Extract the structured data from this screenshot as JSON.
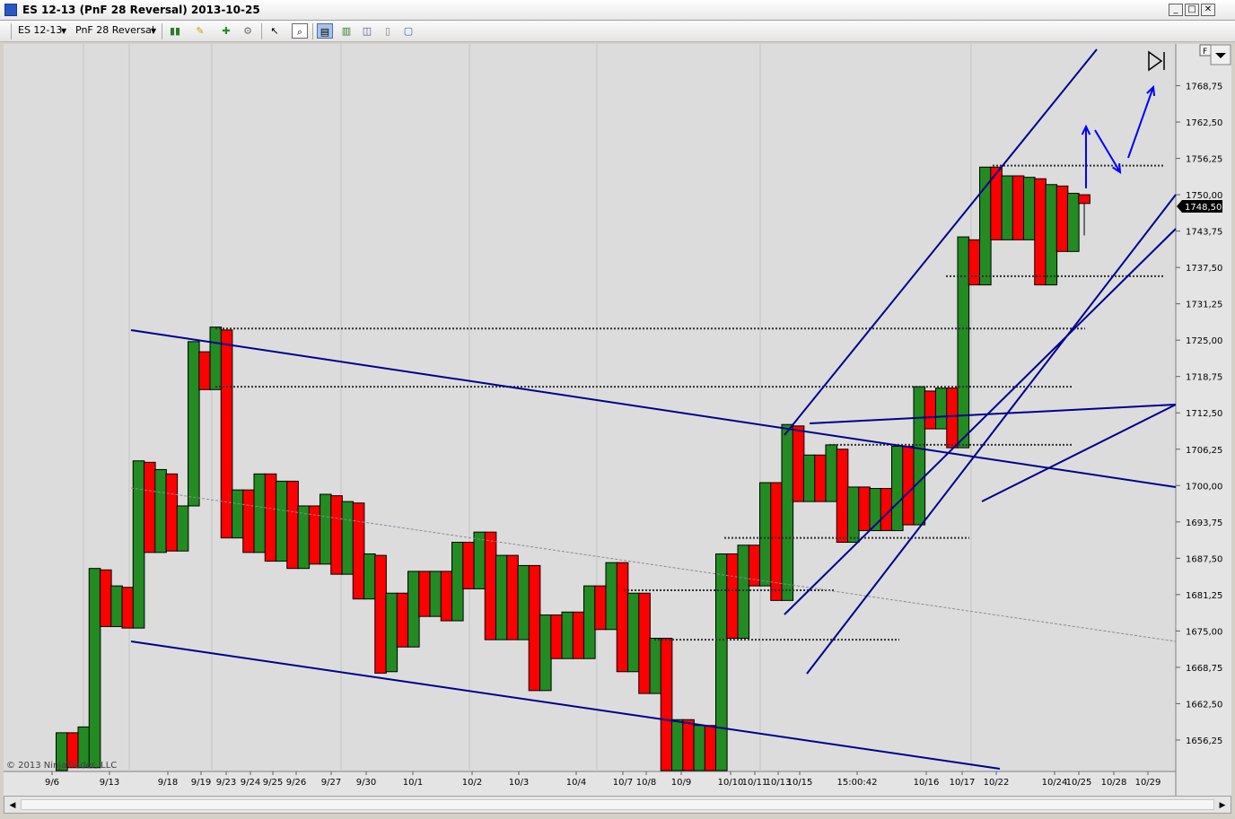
{
  "window": {
    "title": "ES 12-13 (PnF 28 Reversal)  2013-10-25",
    "buttons": [
      "_",
      "□",
      "✕"
    ]
  },
  "toolbar": {
    "instrument": "ES 12-13",
    "period": "PnF 28 Reversal",
    "icons": [
      "bar-style-icon",
      "draw-pencil-icon",
      "add-indicator-icon",
      "strategy-icon",
      "cursor-icon",
      "zoom-icon",
      "chart-trader-icon",
      "data-box-icon",
      "indicator-icon",
      "properties-icon",
      "template-icon"
    ]
  },
  "colors": {
    "up": "#228b22",
    "down": "#ff0000",
    "trendline": "#00008b",
    "arrow": "#0000ff",
    "background": "#dcdcdc"
  },
  "chart_data": {
    "type": "bar",
    "subtype": "point-and-figure reversal columns",
    "ylim": [
      1651,
      1775
    ],
    "grid": true,
    "copyright": "© 2013 NinjaTrader, LLC",
    "last_price_label": "1748,50",
    "y_ticks": [
      "1768,75",
      "1762,50",
      "1756,25",
      "1750,00",
      "1743,75",
      "1737,50",
      "1731,25",
      "1725,00",
      "1718,75",
      "1712,50",
      "1706,25",
      "1700,00",
      "1693,75",
      "1687,50",
      "1681,25",
      "1675,00",
      "1668,75",
      "1662,50",
      "1656,25"
    ],
    "x_ticks": [
      "9/6",
      "9/13",
      "9/18",
      "9/19",
      "9/23",
      "9/24",
      "9/25",
      "9/26",
      "9/27",
      "9/30",
      "10/1",
      "10/2",
      "10/3",
      "10/4",
      "10/7",
      "10/8",
      "10/9",
      "10/10",
      "10/11",
      "10/13",
      "10/15",
      "15:00:42",
      "10/16",
      "10/17",
      "10/22",
      "10/24",
      "10/25",
      "10/28",
      "10/29"
    ],
    "columns": [
      {
        "o": 1651,
        "c": 1657.5
      },
      {
        "o": 1657.5,
        "c": 1651.5
      },
      {
        "o": 1651.5,
        "c": 1658.5
      },
      {
        "o": 1651.5,
        "c": 1685.75
      },
      {
        "o": 1685.5,
        "c": 1675.75
      },
      {
        "o": 1675.75,
        "c": 1682.75
      },
      {
        "o": 1682.5,
        "c": 1675.5
      },
      {
        "o": 1675.5,
        "c": 1704.25
      },
      {
        "o": 1704,
        "c": 1688.5
      },
      {
        "o": 1688.5,
        "c": 1702.75
      },
      {
        "o": 1702,
        "c": 1688.75
      },
      {
        "o": 1688.75,
        "c": 1696.5
      },
      {
        "o": 1696.5,
        "c": 1724.75
      },
      {
        "o": 1723,
        "c": 1716.5
      },
      {
        "o": 1716.5,
        "c": 1727.25
      },
      {
        "o": 1726.75,
        "c": 1691
      },
      {
        "o": 1691,
        "c": 1699.25
      },
      {
        "o": 1699.25,
        "c": 1688.5
      },
      {
        "o": 1688.5,
        "c": 1702
      },
      {
        "o": 1702,
        "c": 1687
      },
      {
        "o": 1687,
        "c": 1700.75
      },
      {
        "o": 1700.75,
        "c": 1685.75
      },
      {
        "o": 1685.75,
        "c": 1696.5
      },
      {
        "o": 1696.5,
        "c": 1686.5
      },
      {
        "o": 1686.5,
        "c": 1698.5
      },
      {
        "o": 1698.25,
        "c": 1684.75
      },
      {
        "o": 1684.75,
        "c": 1697.25
      },
      {
        "o": 1697,
        "c": 1680.5
      },
      {
        "o": 1680.5,
        "c": 1688.25
      },
      {
        "o": 1688,
        "c": 1667.75
      },
      {
        "o": 1668,
        "c": 1681.5
      },
      {
        "o": 1681.5,
        "c": 1672.25
      },
      {
        "o": 1672.25,
        "c": 1685.25
      },
      {
        "o": 1685.25,
        "c": 1677.5
      },
      {
        "o": 1677.5,
        "c": 1685.25
      },
      {
        "o": 1685.25,
        "c": 1676.75
      },
      {
        "o": 1676.75,
        "c": 1690.25
      },
      {
        "o": 1690.25,
        "c": 1682.25
      },
      {
        "o": 1682.25,
        "c": 1692
      },
      {
        "o": 1692,
        "c": 1673.5
      },
      {
        "o": 1673.5,
        "c": 1688
      },
      {
        "o": 1688,
        "c": 1673.5
      },
      {
        "o": 1673.5,
        "c": 1686.25
      },
      {
        "o": 1686.25,
        "c": 1664.75
      },
      {
        "o": 1664.75,
        "c": 1677.75
      },
      {
        "o": 1677.75,
        "c": 1670.25
      },
      {
        "o": 1670.25,
        "c": 1678.25
      },
      {
        "o": 1678.25,
        "c": 1670.25
      },
      {
        "o": 1670.25,
        "c": 1682.75
      },
      {
        "o": 1682.75,
        "c": 1675.25
      },
      {
        "o": 1675.25,
        "c": 1686.75
      },
      {
        "o": 1686.75,
        "c": 1668
      },
      {
        "o": 1668,
        "c": 1681.5
      },
      {
        "o": 1681.5,
        "c": 1664.25
      },
      {
        "o": 1664.25,
        "c": 1673.75
      },
      {
        "o": 1673.75,
        "c": 1651
      },
      {
        "o": 1651,
        "c": 1659.75
      },
      {
        "o": 1659.75,
        "c": 1651
      },
      {
        "o": 1651,
        "c": 1658.75
      },
      {
        "o": 1658.75,
        "c": 1651
      },
      {
        "o": 1651,
        "c": 1688.25
      },
      {
        "o": 1688.25,
        "c": 1673.75
      },
      {
        "o": 1673.75,
        "c": 1689.75
      },
      {
        "o": 1689.75,
        "c": 1682.75
      },
      {
        "o": 1682.75,
        "c": 1700.5
      },
      {
        "o": 1700.5,
        "c": 1680.25
      },
      {
        "o": 1680.25,
        "c": 1710.5
      },
      {
        "o": 1710.25,
        "c": 1697.25
      },
      {
        "o": 1697.25,
        "c": 1705.25
      },
      {
        "o": 1705.25,
        "c": 1697.25
      },
      {
        "o": 1697.25,
        "c": 1707
      },
      {
        "o": 1706.25,
        "c": 1690.25
      },
      {
        "o": 1690.25,
        "c": 1699.75
      },
      {
        "o": 1699.75,
        "c": 1692.25
      },
      {
        "o": 1692.25,
        "c": 1699.5
      },
      {
        "o": 1699.5,
        "c": 1692.25
      },
      {
        "o": 1692.25,
        "c": 1706.75
      },
      {
        "o": 1706.75,
        "c": 1693.25
      },
      {
        "o": 1693.25,
        "c": 1717
      },
      {
        "o": 1716.25,
        "c": 1709.75
      },
      {
        "o": 1709.75,
        "c": 1716.75
      },
      {
        "o": 1716.75,
        "c": 1706.5
      },
      {
        "o": 1706.5,
        "c": 1742.75
      },
      {
        "o": 1742.25,
        "c": 1734.5
      },
      {
        "o": 1734.5,
        "c": 1754.75
      },
      {
        "o": 1754.75,
        "c": 1742.25
      },
      {
        "o": 1742.25,
        "c": 1753.25
      },
      {
        "o": 1753.25,
        "c": 1742.25
      },
      {
        "o": 1742.25,
        "c": 1753
      },
      {
        "o": 1752.75,
        "c": 1734.5
      },
      {
        "o": 1734.5,
        "c": 1751.75
      },
      {
        "o": 1751.5,
        "c": 1740.25
      },
      {
        "o": 1740.25,
        "c": 1750.25
      },
      {
        "o": 1750,
        "c": 1748.5
      }
    ]
  }
}
